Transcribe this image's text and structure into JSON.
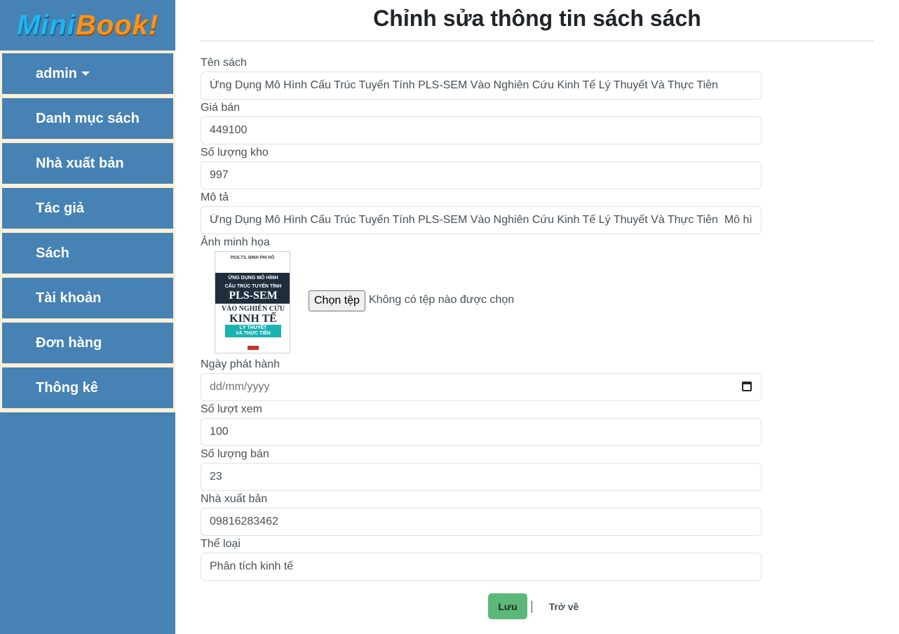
{
  "sidebar": {
    "logo": {
      "part1": "Mini",
      "part2": "Book!"
    },
    "items": [
      {
        "label": "admin"
      },
      {
        "label": "Danh mục sách"
      },
      {
        "label": "Nhà xuất bản"
      },
      {
        "label": "Tác giả"
      },
      {
        "label": "Sách"
      },
      {
        "label": "Tài khoản"
      },
      {
        "label": "Đơn hàng"
      },
      {
        "label": "Thông kê"
      }
    ]
  },
  "page": {
    "title": "Chỉnh sửa thông tin sách sách"
  },
  "form": {
    "title_field": {
      "label": "Tên sách",
      "value": "Ứng Dụng Mô Hình Cấu Trúc Tuyến Tính PLS-SEM Vào Nghiên Cứu Kinh Tế Lý Thuyết Và Thực Tiễn"
    },
    "price": {
      "label": "Giá bán",
      "value": "449100"
    },
    "stock": {
      "label": "Số lượng kho",
      "value": "997"
    },
    "description": {
      "label": "Mô tả",
      "value": "Ứng Dụng Mô Hình Cấu Trúc Tuyến Tính PLS-SEM Vào Nghiên Cứu Kinh Tế Lý Thuyết Và Thực Tiễn  Mô hình c"
    },
    "image": {
      "label": "Ảnh minh họa",
      "choose_button": "Chọn tệp",
      "status": "Không có tệp nào được chọn",
      "cover": {
        "author": "PGS.TS. ĐINH PHI HỔ",
        "line1": "ỨNG DỤNG MÔ HÌNH",
        "line2": "CẤU TRÚC TUYẾN TÍNH",
        "line3": "PLS-SEM",
        "line4": "VÀO NGHIÊN CỨU",
        "line5": "KINH TẾ",
        "line6": "LÝ THUYẾT",
        "line7": "VÀ THỰC TIỄN"
      }
    },
    "release_date": {
      "label": "Ngày phát hành",
      "placeholder": "dd/mm/yyyy"
    },
    "views": {
      "label": "Số lượt xem",
      "value": "100"
    },
    "sold": {
      "label": "Số lượng bán",
      "value": "23"
    },
    "publisher": {
      "label": "Nhà xuất bản",
      "value": "09816283462"
    },
    "category": {
      "label": "Thể loại",
      "value": "Phân tích kinh tế"
    }
  },
  "actions": {
    "save": "Lưu",
    "separator": "|",
    "back": "Trở về"
  },
  "colors": {
    "sidebar": "#4682b4",
    "menu_border": "#fcf0d6",
    "save_button": "#5cb878"
  }
}
